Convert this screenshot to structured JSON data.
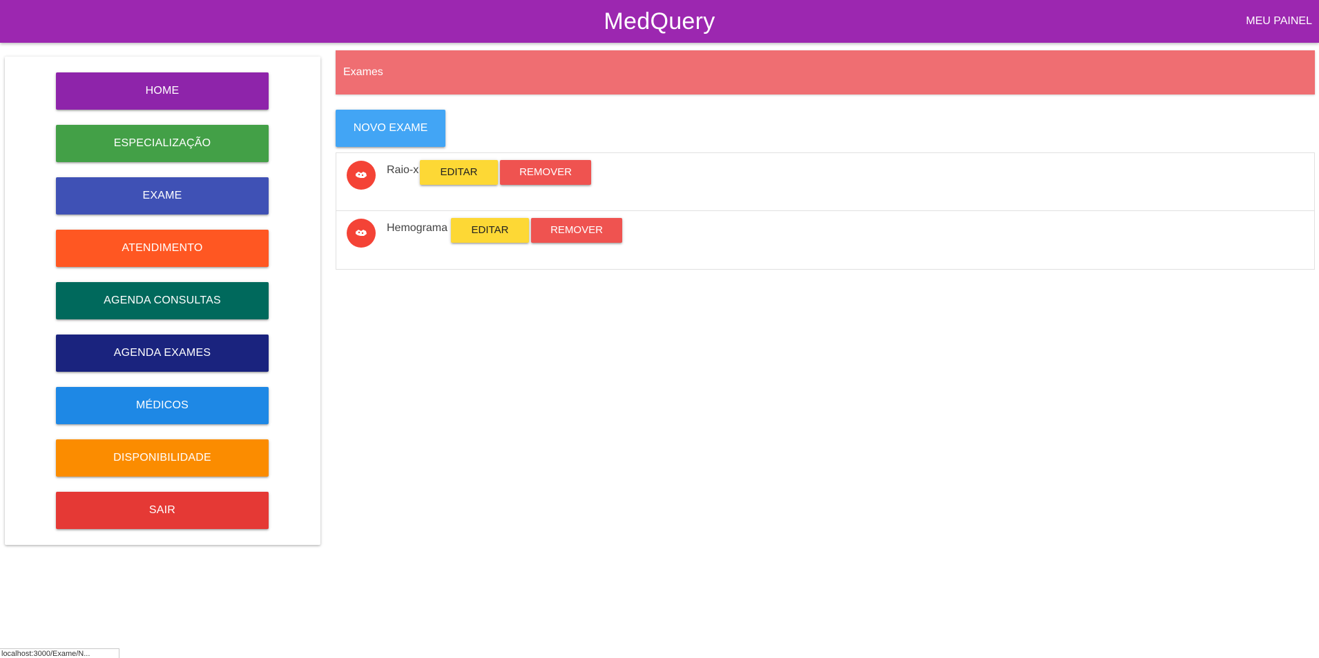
{
  "app": {
    "title": "MedQuery",
    "panel_link": "MEU PAINEL",
    "bar_color": "#9c27b0"
  },
  "sidebar": {
    "items": [
      {
        "label": "HOME",
        "color": "#8e24aa"
      },
      {
        "label": "ESPECIALIZAÇÃO",
        "color": "#43a047"
      },
      {
        "label": "EXAME",
        "color": "#3f51b5"
      },
      {
        "label": "ATENDIMENTO",
        "color": "#ff5722"
      },
      {
        "label": "AGENDA CONSULTAS",
        "color": "#00695c"
      },
      {
        "label": "AGENDA EXAMES",
        "color": "#1a237e"
      },
      {
        "label": "MÉDICOS",
        "color": "#1e88e5"
      },
      {
        "label": "DISPONIBILIDADE",
        "color": "#fb8c00"
      },
      {
        "label": "SAIR",
        "color": "#e53935"
      }
    ]
  },
  "main": {
    "header_label": "Exames",
    "new_button": "NOVO EXAME",
    "exams": [
      {
        "name": "Raio-x",
        "edit_label": "EDITAR",
        "remove_label": "REMOVER",
        "icon": "hospital-icon"
      },
      {
        "name": "Hemograma",
        "edit_label": "EDITAR",
        "remove_label": "REMOVER",
        "icon": "hospital-icon"
      }
    ]
  },
  "status_bar": {
    "text": "localhost:3000/Exame/N..."
  }
}
